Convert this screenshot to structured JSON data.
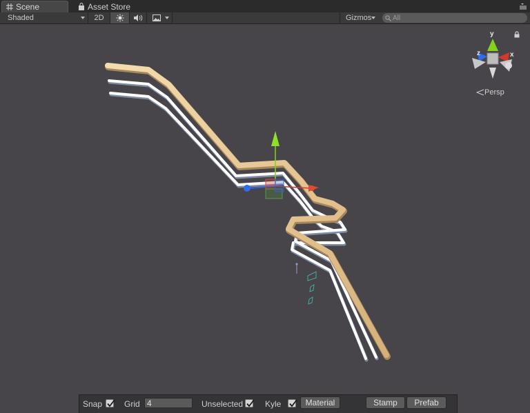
{
  "tabs": {
    "scene": "Scene",
    "asset_store": "Asset Store"
  },
  "toolbar": {
    "draw_mode": "Shaded",
    "mode_2d": "2D",
    "gizmos": "Gizmos",
    "search_placeholder": "All"
  },
  "viewport": {
    "projection": "Persp",
    "axis_x": "x",
    "axis_y": "y",
    "axis_z": "z"
  },
  "bottom": {
    "snap_label": "Snap",
    "snap_checked": true,
    "grid_label": "Grid",
    "grid_value": "4",
    "unselected_label": "Unselected",
    "unselected_checked": true,
    "kyle_label": "Kyle",
    "kyle_checked": true,
    "material_button": "Material",
    "stamp_button": "Stamp",
    "prefab_button": "Prefab"
  },
  "colors": {
    "viewport_bg": "#474549",
    "rail_main": "#e6c58f",
    "rail_white": "#ffffff",
    "axis_x": "#d33a2a",
    "axis_y": "#86d11e",
    "axis_z": "#2f6bf0"
  }
}
